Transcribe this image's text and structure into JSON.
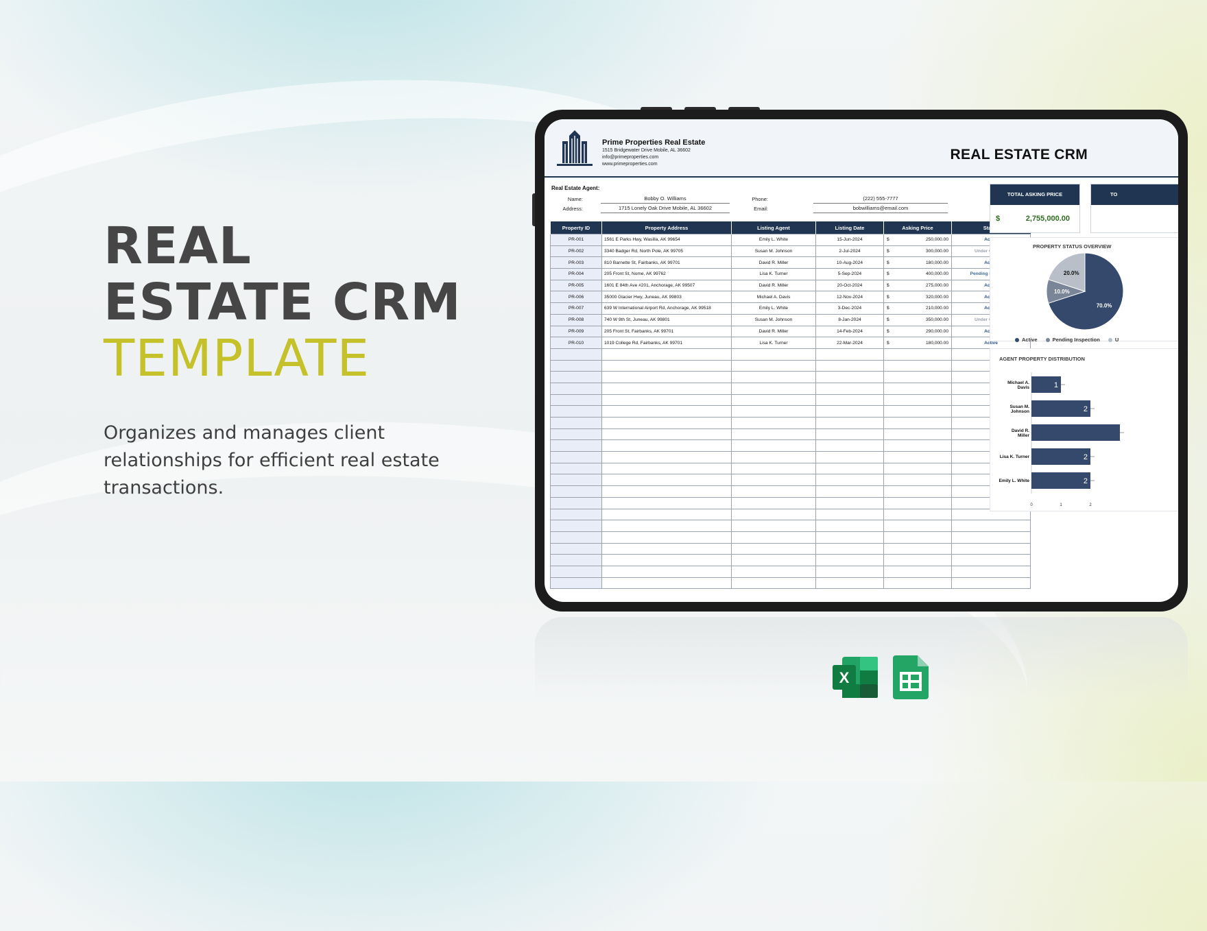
{
  "hero": {
    "line1": "REAL",
    "line2": "ESTATE CRM",
    "line3": "TEMPLATE",
    "description": "Organizes and manages client relationships for efficient real estate transactions."
  },
  "company": {
    "name": "Prime Properties Real Estate",
    "address": "1515 Bridgewater Drive Mobile, AL 36602",
    "email": "info@primeproperties.com",
    "website": "www.primeproperties.com"
  },
  "sheet_title": "REAL ESTATE CRM",
  "agent": {
    "heading": "Real Estate Agent:",
    "name_label": "Name:",
    "name": "Bobby O. Williams",
    "address_label": "Address:",
    "address": "1715 Lonely Oak Drive Mobile, AL 36602",
    "phone_label": "Phone:",
    "phone": "(222) 555-7777",
    "email_label": "Email:",
    "email": "bobwilliams@email.com"
  },
  "table": {
    "headers": [
      "Property ID",
      "Property Address",
      "Listing Agent",
      "Listing Date",
      "Asking Price",
      "Status"
    ],
    "rows": [
      {
        "id": "PR-001",
        "address": "1561 E Parks Hwy, Wasilla, AK 99654",
        "agent": "Emily L. White",
        "date": "15-Jun-2024",
        "currency": "$",
        "price": "250,000.00",
        "status": "Active"
      },
      {
        "id": "PR-002",
        "address": "3340 Badger Rd, North Pole, AK 99705",
        "agent": "Susan M. Johnson",
        "date": "2-Jul-2024",
        "currency": "$",
        "price": "300,000.00",
        "status": "Under Contract"
      },
      {
        "id": "PR-003",
        "address": "810 Barnette St, Fairbanks, AK 99701",
        "agent": "David R. Miller",
        "date": "10-Aug-2024",
        "currency": "$",
        "price": "180,000.00",
        "status": "Active"
      },
      {
        "id": "PR-004",
        "address": "205 Front St, Nome, AK 99762",
        "agent": "Lisa K. Turner",
        "date": "5-Sep-2024",
        "currency": "$",
        "price": "400,000.00",
        "status": "Pending Inspection"
      },
      {
        "id": "PR-005",
        "address": "1601 E 84th Ave #201, Anchorage, AK 99507",
        "agent": "David R. Miller",
        "date": "20-Oct-2024",
        "currency": "$",
        "price": "275,000.00",
        "status": "Active"
      },
      {
        "id": "PR-006",
        "address": "35000 Glacier Hwy, Juneau, AK 99803",
        "agent": "Michael A. Davis",
        "date": "12-Nov-2024",
        "currency": "$",
        "price": "320,000.00",
        "status": "Active"
      },
      {
        "id": "PR-007",
        "address": "639 W International Airport Rd, Anchorage, AK 99518",
        "agent": "Emily L. White",
        "date": "3-Dec-2024",
        "currency": "$",
        "price": "210,000.00",
        "status": "Active"
      },
      {
        "id": "PR-008",
        "address": "740 W 9th St, Juneau, AK 99801",
        "agent": "Susan M. Johnson",
        "date": "8-Jan-2024",
        "currency": "$",
        "price": "350,000.00",
        "status": "Under Contract"
      },
      {
        "id": "PR-009",
        "address": "205 Front St, Fairbanks, AK 99701",
        "agent": "David R. Miller",
        "date": "14-Feb-2024",
        "currency": "$",
        "price": "290,000.00",
        "status": "Active"
      },
      {
        "id": "PR-010",
        "address": "1019 College Rd, Fairbanks, AK 99701",
        "agent": "Lisa K. Turner",
        "date": "22-Mar-2024",
        "currency": "$",
        "price": "180,000.00",
        "status": "Active"
      }
    ]
  },
  "total_card": {
    "label": "TOTAL ASKING PRICE",
    "currency": "$",
    "value": "2,755,000.00"
  },
  "second_card": {
    "label": "TO"
  },
  "colors": {
    "navy": "#1f3552",
    "accent_yellow": "#c4c12a",
    "money_green": "#2f6c1f"
  },
  "chart_data": [
    {
      "type": "pie",
      "title": "PROPERTY STATUS OVERVIEW",
      "labels": [
        "Active",
        "Pending Inspection",
        "U"
      ],
      "values": [
        70.0,
        10.0,
        20.0
      ],
      "value_labels": [
        "70.0%",
        "10.0%",
        "20.0%"
      ],
      "colors": [
        "#34496b",
        "#7a8597",
        "#b9bfc8"
      ],
      "legend": "bottom"
    },
    {
      "type": "bar",
      "title": "AGENT PROPERTY DISTRIBUTION",
      "orientation": "horizontal",
      "categories": [
        "Michael A. Davis",
        "Susan M. Johnson",
        "David R. Miller",
        "Lisa K. Turner",
        "Emily L. White"
      ],
      "values": [
        1,
        2,
        3,
        2,
        2
      ],
      "value_labels": [
        "1",
        "2",
        "",
        "2",
        "2"
      ],
      "x_ticks": [
        "0",
        "1",
        "2"
      ],
      "color": "#34496b"
    }
  ],
  "file_icons": [
    "excel-icon",
    "google-sheets-icon"
  ]
}
